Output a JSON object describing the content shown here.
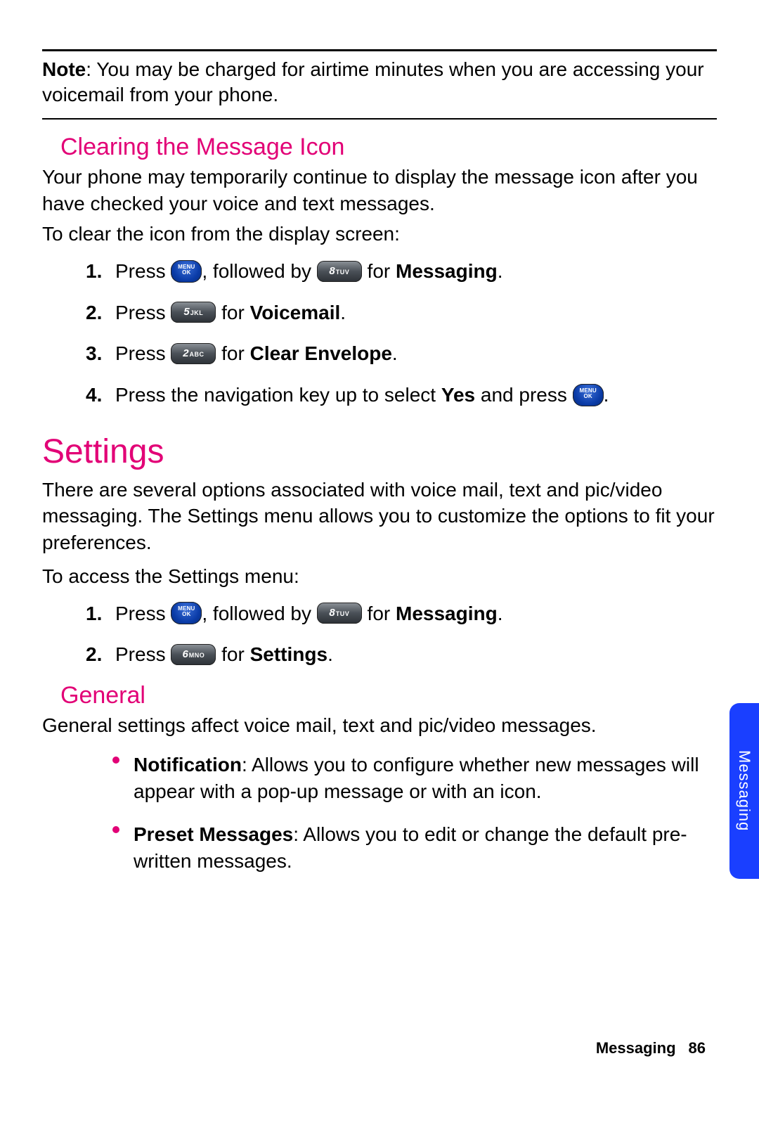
{
  "note": {
    "label": "Note",
    "text": ": You may be charged for airtime minutes when you are accessing your voicemail from your phone."
  },
  "section_clearing": {
    "heading": "Clearing the Message Icon",
    "para1": "Your phone may temporarily continue to display the message icon after you have checked your voice and text messages.",
    "para2": "To clear the icon from the display screen:",
    "steps": {
      "s1": {
        "num": "1.",
        "a": "Press ",
        "b": ", followed by ",
        "c": " for ",
        "d": "Messaging",
        "e": "."
      },
      "s2": {
        "num": "2.",
        "a": "Press ",
        "b": " for ",
        "c": "Voicemail",
        "d": "."
      },
      "s3": {
        "num": "3.",
        "a": "Press ",
        "b": " for ",
        "c": "Clear Envelope",
        "d": "."
      },
      "s4": {
        "num": "4.",
        "a": "Press the navigation key up to select ",
        "b": "Yes",
        "c": " and press ",
        "d": "."
      }
    }
  },
  "section_settings": {
    "heading": "Settings",
    "para1": "There are several options associated with voice mail, text and pic/video messaging. The Settings menu allows you to customize the options to fit your preferences.",
    "para2": "To access the Settings menu:",
    "steps": {
      "s1": {
        "num": "1.",
        "a": "Press ",
        "b": ", followed by ",
        "c": " for ",
        "d": "Messaging",
        "e": "."
      },
      "s2": {
        "num": "2.",
        "a": "Press ",
        "b": " for ",
        "c": "Settings",
        "d": "."
      }
    }
  },
  "section_general": {
    "heading": "General",
    "para": "General settings affect voice mail, text and pic/video messages.",
    "bullets": {
      "b1": {
        "label": "Notification",
        "text": ": Allows you to configure whether new messages will appear with a pop-up message or with an icon."
      },
      "b2": {
        "label": "Preset Messages",
        "text": ": Allows you to edit or change the default pre-written messages."
      }
    }
  },
  "keys": {
    "menu_l1": "MENU",
    "menu_l2": "OK",
    "k8": "8",
    "k8s": "TUV",
    "k5": "5",
    "k5s": "JKL",
    "k2": "2",
    "k2s": "ABC",
    "k6": "6",
    "k6s": "MNO"
  },
  "side_tab": "Messaging",
  "footer": {
    "section": "Messaging",
    "page": "86"
  }
}
